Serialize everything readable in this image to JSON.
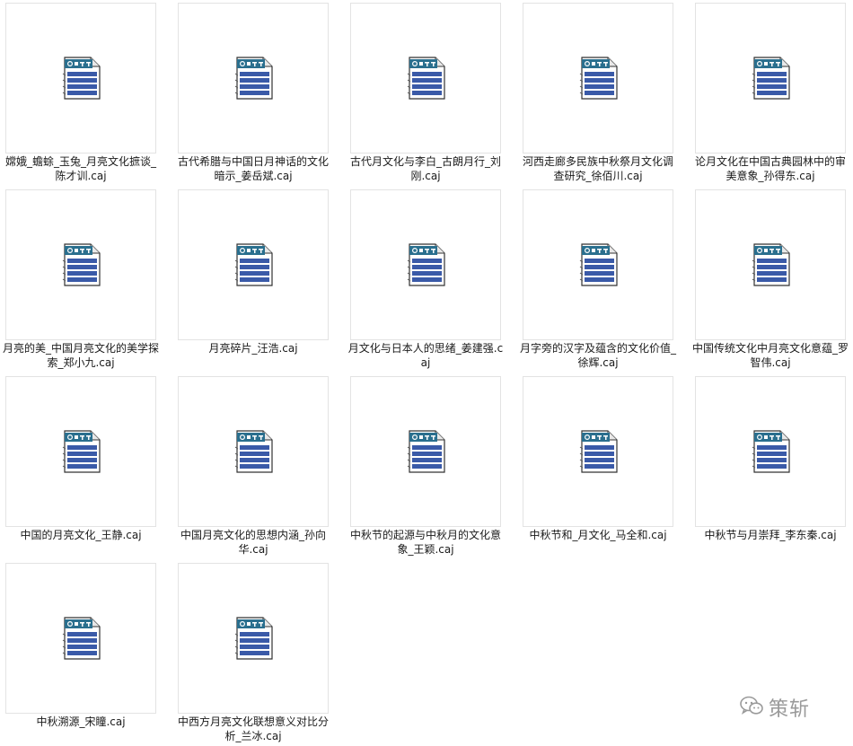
{
  "files": [
    {
      "name": "嫦娥_蟾蜍_玉兔_月亮文化摭谈_陈才训.caj",
      "icon": "caj-file-icon"
    },
    {
      "name": "古代希腊与中国日月神话的文化暗示_姜岳斌.caj",
      "icon": "caj-file-icon"
    },
    {
      "name": "古代月文化与李白_古朗月行_刘刚.caj",
      "icon": "caj-file-icon"
    },
    {
      "name": "河西走廊多民族中秋祭月文化调查研究_徐佰川.caj",
      "icon": "caj-file-icon"
    },
    {
      "name": "论月文化在中国古典园林中的审美意象_孙得东.caj",
      "icon": "caj-file-icon"
    },
    {
      "name": "月亮的美_中国月亮文化的美学探索_郑小九.caj",
      "icon": "caj-file-icon"
    },
    {
      "name": "月亮碎片_汪浩.caj",
      "icon": "caj-file-icon"
    },
    {
      "name": "月文化与日本人的思绪_姜建强.caj",
      "icon": "caj-file-icon"
    },
    {
      "name": "月字旁的汉字及蕴含的文化价值_徐辉.caj",
      "icon": "caj-file-icon"
    },
    {
      "name": "中国传统文化中月亮文化意蕴_罗智伟.caj",
      "icon": "caj-file-icon"
    },
    {
      "name": "中国的月亮文化_王静.caj",
      "icon": "caj-file-icon"
    },
    {
      "name": "中国月亮文化的思想内涵_孙向华.caj",
      "icon": "caj-file-icon"
    },
    {
      "name": "中秋节的起源与中秋月的文化意象_王颖.caj",
      "icon": "caj-file-icon"
    },
    {
      "name": "中秋节和_月文化_马全和.caj",
      "icon": "caj-file-icon"
    },
    {
      "name": "中秋节与月崇拜_李东秦.caj",
      "icon": "caj-file-icon"
    },
    {
      "name": "中秋溯源_宋瞳.caj",
      "icon": "caj-file-icon"
    },
    {
      "name": "中西方月亮文化联想意义对比分析_兰冰.caj",
      "icon": "caj-file-icon"
    }
  ],
  "watermark": {
    "text": "策斩",
    "icon": "wechat-icon"
  },
  "colors": {
    "icon_header": "#2a6f8e",
    "icon_stripes": "#3a5aa8",
    "tile_border": "#e3e3e3"
  }
}
